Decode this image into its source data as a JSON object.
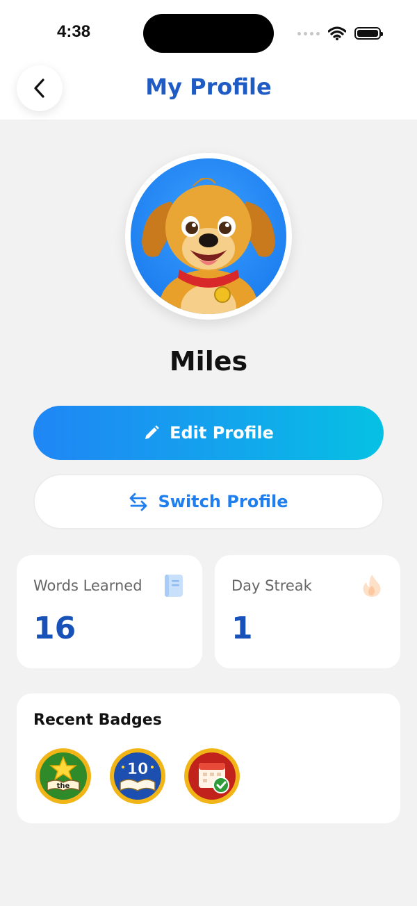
{
  "status": {
    "time": "4:38"
  },
  "nav": {
    "title": "My Profile"
  },
  "profile": {
    "name": "Miles"
  },
  "actions": {
    "edit_label": "Edit Profile",
    "switch_label": "Switch Profile"
  },
  "stats": [
    {
      "label": "Words Learned",
      "value": "16",
      "icon": "book-icon"
    },
    {
      "label": "Day Streak",
      "value": "1",
      "icon": "flame-icon"
    }
  ],
  "badges": {
    "title": "Recent Badges",
    "items": [
      {
        "icon": "star-book-badge-icon",
        "text": "the"
      },
      {
        "icon": "ten-books-badge-icon",
        "text": "10"
      },
      {
        "icon": "calendar-check-badge-icon",
        "text": ""
      }
    ]
  },
  "colors": {
    "accent": "#1f5bc4",
    "edit_gradient_start": "#1f86f5",
    "edit_gradient_end": "#06c1e3",
    "stat_value": "#1852b8"
  }
}
